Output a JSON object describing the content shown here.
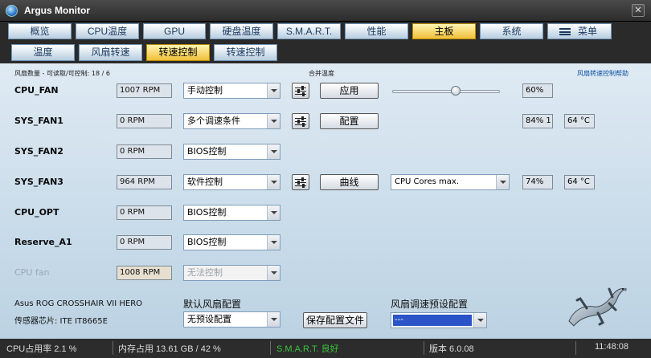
{
  "window": {
    "title": "Argus Monitor",
    "close": "✕"
  },
  "tabs": [
    "概览",
    "CPU温度",
    "GPU",
    "硬盘温度",
    "S.M.A.R.T.",
    "性能",
    "主板",
    "系统",
    "菜单"
  ],
  "subtabs": [
    "温度",
    "风扇转速",
    "转速控制",
    "转速控制"
  ],
  "header": {
    "left": "风扇数量 - 可读取/可控制: 18 / 6",
    "center": "合并温度",
    "right": "风扇转速控制帮助"
  },
  "fans": [
    {
      "name": "CPU_FAN",
      "rpm": "1007 RPM",
      "mode": "手动控制",
      "button": "应用",
      "pct": "60%",
      "slider_pct": 60
    },
    {
      "name": "SYS_FAN1",
      "rpm": "0 RPM",
      "mode": "多个调速条件",
      "button": "配置",
      "pct": "84% 1",
      "temp": "64 °C"
    },
    {
      "name": "SYS_FAN2",
      "rpm": "0 RPM",
      "mode": "BIOS控制"
    },
    {
      "name": "SYS_FAN3",
      "rpm": "964 RPM",
      "mode": "软件控制",
      "button": "曲线",
      "source": "CPU Cores max.",
      "pct": "74%",
      "temp": "64 °C"
    },
    {
      "name": "CPU_OPT",
      "rpm": "0 RPM",
      "mode": "BIOS控制"
    },
    {
      "name": "Reserve_A1",
      "rpm": "0 RPM",
      "mode": "BIOS控制"
    },
    {
      "name": "CPU fan",
      "rpm": "1008 RPM",
      "mode": "无法控制"
    }
  ],
  "bottom": {
    "board": "Asus ROG CROSSHAIR VII HERO",
    "chip": "传感器芯片: ITE IT8665E",
    "default_label": "默认风扇配置",
    "default_value": "无预设配置",
    "save_button": "保存配置文件",
    "preset_label": "风扇调速预设配置",
    "preset_value": "---"
  },
  "status": {
    "cpu": "CPU占用率 2.1 %",
    "mem": "内存占用 13.61 GB / 42 %",
    "smart": "S.M.A.R.T. 良好",
    "version": "版本 6.0.08",
    "time": "11:48:08"
  }
}
